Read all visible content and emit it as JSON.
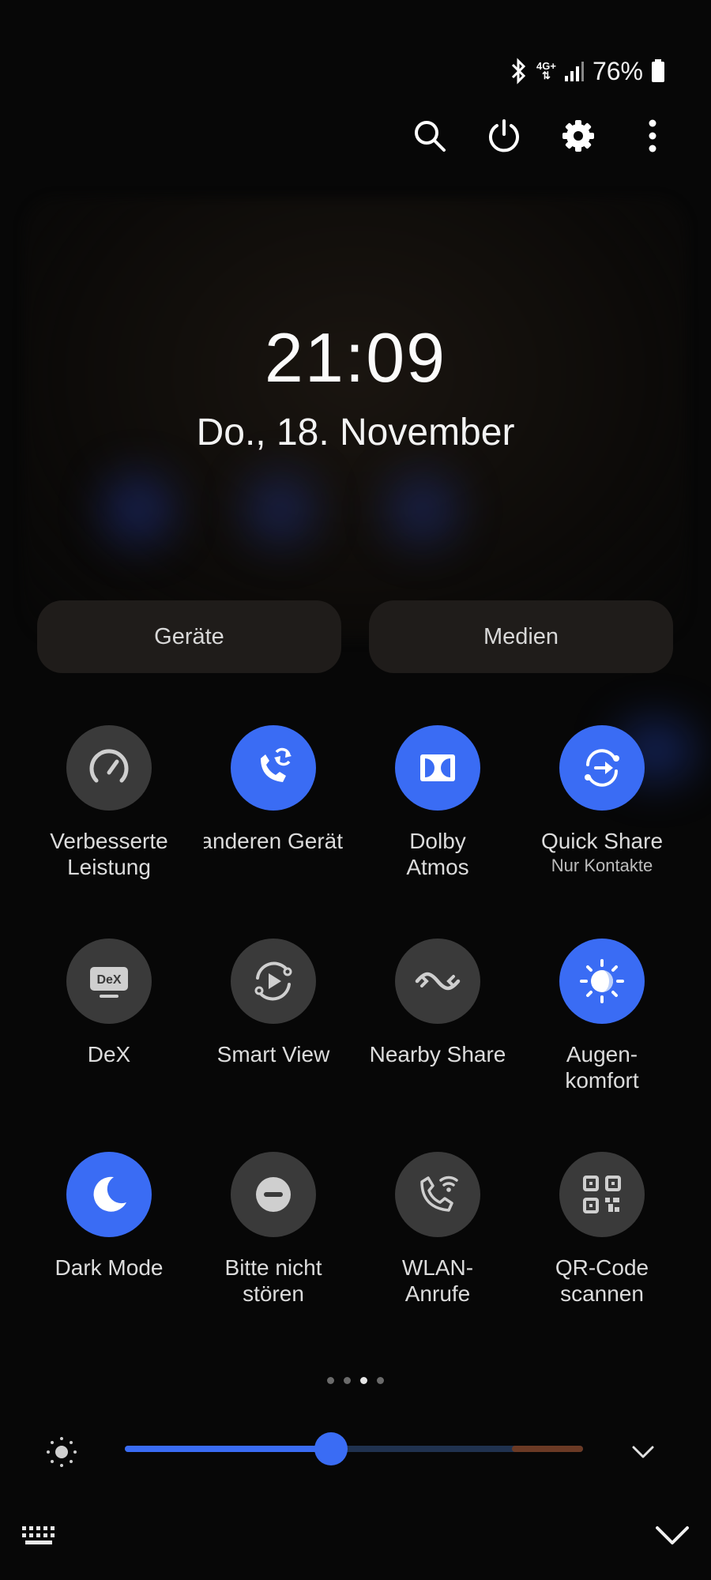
{
  "status_bar": {
    "network": "4G+",
    "battery": "76%",
    "bluetooth_icon": "bluetooth-icon",
    "signal_icon": "signal-bars-icon",
    "battery_icon": "battery-icon"
  },
  "top_actions": [
    {
      "name": "search",
      "icon": "search-icon"
    },
    {
      "name": "power",
      "icon": "power-icon"
    },
    {
      "name": "settings",
      "icon": "gear-icon"
    },
    {
      "name": "more",
      "icon": "more-vertical-icon"
    }
  ],
  "clock": {
    "time": "21:09",
    "date": "Do., 18. November"
  },
  "pills": {
    "devices": "Geräte",
    "media": "Medien"
  },
  "tiles": [
    {
      "label": "Verbesserte\nLeistung",
      "sub": "",
      "state": "off",
      "icon": "speedometer-icon"
    },
    {
      "label": "Anrufe/SMS auf anderen Gerät",
      "sub": "",
      "state": "on",
      "icon": "call-sync-icon"
    },
    {
      "label": "Dolby\nAtmos",
      "sub": "",
      "state": "on",
      "icon": "dolby-icon"
    },
    {
      "label": "Quick Share",
      "sub": "Nur Kontakte",
      "state": "on",
      "icon": "quick-share-icon"
    },
    {
      "label": "DeX",
      "sub": "",
      "state": "off",
      "icon": "dex-icon"
    },
    {
      "label": "Smart View",
      "sub": "",
      "state": "off",
      "icon": "smart-view-icon"
    },
    {
      "label": "Nearby Share",
      "sub": "",
      "state": "off",
      "icon": "nearby-share-icon"
    },
    {
      "label": "Augen-\nkomfort",
      "sub": "",
      "state": "on",
      "icon": "eye-comfort-icon"
    },
    {
      "label": "Dark Mode",
      "sub": "",
      "state": "on",
      "icon": "moon-icon"
    },
    {
      "label": "Bitte nicht\nstören",
      "sub": "",
      "state": "off",
      "icon": "do-not-disturb-icon"
    },
    {
      "label": "WLAN-\nAnrufe",
      "sub": "",
      "state": "off",
      "icon": "wifi-calling-icon"
    },
    {
      "label": "QR-Code\nscannen",
      "sub": "",
      "state": "off",
      "icon": "qr-code-icon"
    }
  ],
  "pager": {
    "pages": 4,
    "current": 3
  },
  "brightness": {
    "level": 0.45,
    "icon": "brightness-icon"
  },
  "colors": {
    "accent": "#3a6cf4",
    "tile_off": "#3a3a3a",
    "pill": "#1f1c1a",
    "background": "#070707"
  }
}
